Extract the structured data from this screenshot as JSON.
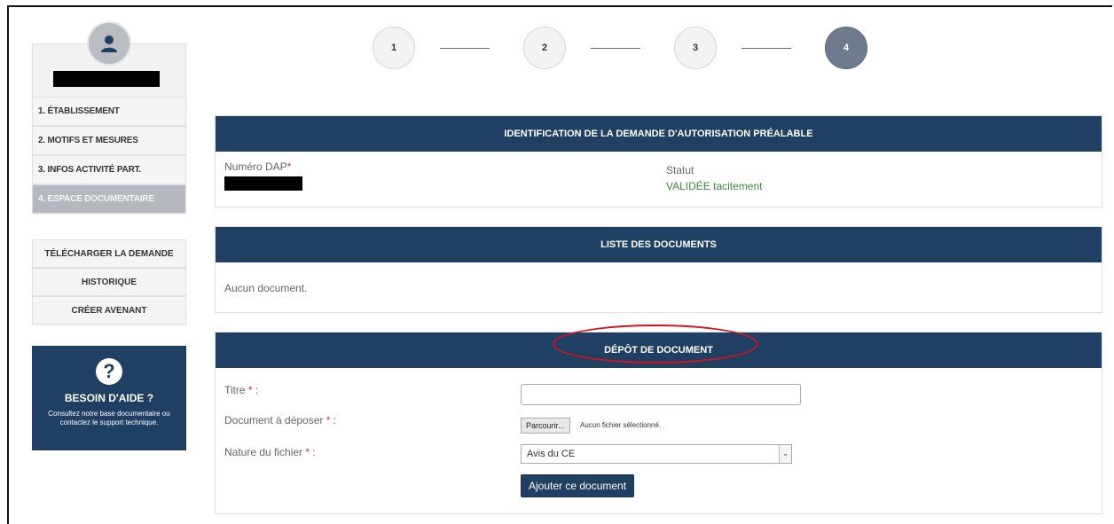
{
  "steps": [
    "1",
    "2",
    "3",
    "4"
  ],
  "current_step": "4",
  "sidebar": {
    "menu": [
      {
        "label": "1. ÉTABLISSEMENT",
        "active": false
      },
      {
        "label": "2. MOTIFS ET MESURES",
        "active": false
      },
      {
        "label": "3. INFOS ACTIVITÉ PART.",
        "active": false
      },
      {
        "label": "4. ESPACE DOCUMENTAIRE",
        "active": true
      }
    ],
    "actions": [
      {
        "label": "TÉLÉCHARGER LA DEMANDE"
      },
      {
        "label": "HISTORIQUE"
      },
      {
        "label": "CRÉER AVENANT"
      }
    ],
    "help": {
      "icon": "?",
      "title": "BESOIN D'AIDE ?",
      "text": "Consultez notre base documentaire ou contactez le support technique."
    }
  },
  "identification": {
    "title": "IDENTIFICATION DE LA DEMANDE D'AUTORISATION PRÉALABLE",
    "numero_label": "Numéro DAP",
    "statut_label": "Statut",
    "statut_value": "VALIDÉE tacitement"
  },
  "documents": {
    "title": "LISTE DES DOCUMENTS",
    "empty_text": "Aucun document."
  },
  "depot": {
    "title": "DÉPÔT DE DOCUMENT",
    "titre_label": "Titre",
    "titre_value": "",
    "document_label": "Document à déposer",
    "browse_label": "Parcourir...",
    "no_file_text": "Aucun fichier sélectionné.",
    "nature_label": "Nature du fichier",
    "nature_value": "Avis du CE",
    "submit_label": "Ajouter ce document",
    "required_mark": "*",
    "colon": " :"
  },
  "colors": {
    "header_navy": "#1f4063",
    "status_green": "#3c8a3c",
    "highlight_red": "#d4131d"
  }
}
